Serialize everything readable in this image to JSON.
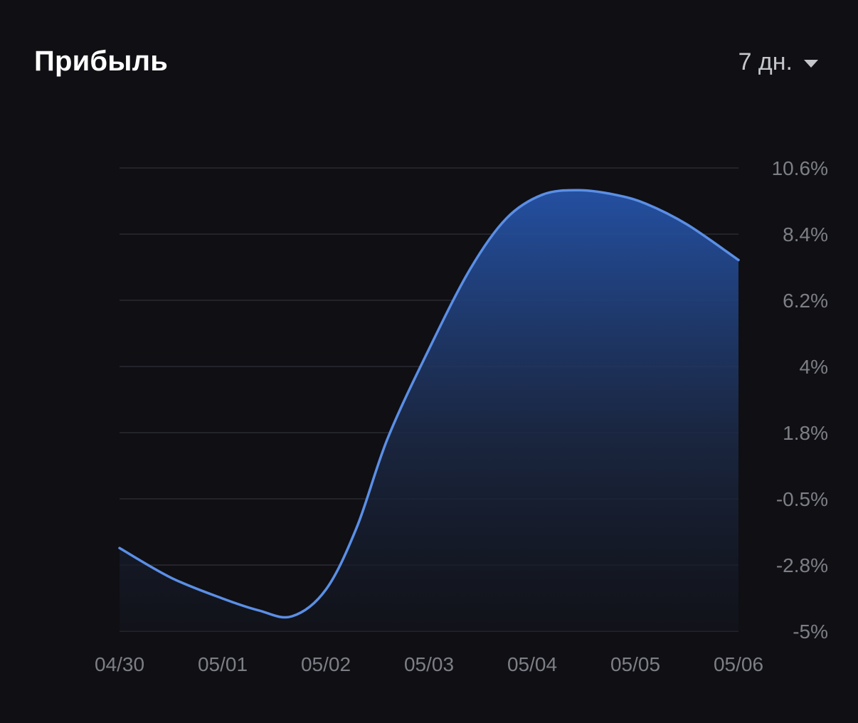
{
  "header": {
    "title": "Прибыль",
    "period_label": "7 дн."
  },
  "icons": {
    "period_dropdown": "caret-down-icon"
  },
  "colors": {
    "background": "#0f0f14",
    "line": "#5b8fe6",
    "area_top": "#2553a8",
    "grid": "#2a2b31",
    "tick_text": "#7d7f86"
  },
  "chart_data": {
    "type": "area",
    "x": [
      "04/30",
      "05/01",
      "05/02",
      "05/03",
      "05/04",
      "05/05",
      "05/06"
    ],
    "points": [
      {
        "x": 0.0,
        "y": -2.2
      },
      {
        "x": 0.5,
        "y": -3.2
      },
      {
        "x": 1.0,
        "y": -3.9
      },
      {
        "x": 1.35,
        "y": -4.3
      },
      {
        "x": 1.67,
        "y": -4.5
      },
      {
        "x": 2.0,
        "y": -3.6
      },
      {
        "x": 2.3,
        "y": -1.5
      },
      {
        "x": 2.6,
        "y": 1.5
      },
      {
        "x": 3.0,
        "y": 4.5
      },
      {
        "x": 3.4,
        "y": 7.2
      },
      {
        "x": 3.75,
        "y": 8.9
      },
      {
        "x": 4.1,
        "y": 9.7
      },
      {
        "x": 4.45,
        "y": 9.85
      },
      {
        "x": 4.8,
        "y": 9.7
      },
      {
        "x": 5.1,
        "y": 9.4
      },
      {
        "x": 5.5,
        "y": 8.7
      },
      {
        "x": 6.0,
        "y": 7.5
      }
    ],
    "y_ticks": [
      "10.6%",
      "8.4%",
      "6.2%",
      "4%",
      "1.8%",
      "-0.5%",
      "-2.8%",
      "-5%"
    ],
    "ylim": [
      -5,
      10.6
    ],
    "xlim": [
      0,
      6
    ],
    "grid": true,
    "y_axis_position": "right",
    "title": "Прибыль"
  }
}
